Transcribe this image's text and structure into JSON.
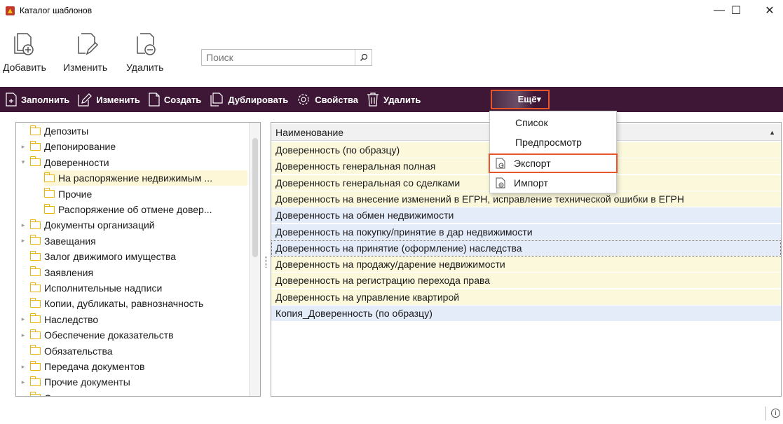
{
  "window": {
    "title": "Каталог шаблонов",
    "minimize": "—",
    "maximize": "☐",
    "close": "✕"
  },
  "ribbon": {
    "add_label": "Добавить",
    "edit_label": "Изменить",
    "delete_label": "Удалить",
    "search_placeholder": "Поиск"
  },
  "toolbar": {
    "fill": "Заполнить",
    "edit": "Изменить",
    "create": "Создать",
    "duplicate": "Дублировать",
    "properties": "Свойства",
    "delete": "Удалить",
    "more": "Ещё▾"
  },
  "menu": {
    "items": [
      "Список",
      "Предпросмотр",
      "Экспорт",
      "Импорт"
    ]
  },
  "tree": {
    "items": [
      {
        "label": "Депозиты",
        "level": 0,
        "expander": ""
      },
      {
        "label": "Депонирование",
        "level": 0,
        "expander": "▸"
      },
      {
        "label": "Доверенности",
        "level": 0,
        "expander": "▾"
      },
      {
        "label": "На распоряжение недвижимым ...",
        "level": 1,
        "expander": "",
        "selected": true
      },
      {
        "label": "Прочие",
        "level": 1,
        "expander": ""
      },
      {
        "label": "Распоряжение об отмене довер...",
        "level": 1,
        "expander": ""
      },
      {
        "label": "Документы организаций",
        "level": 0,
        "expander": "▸"
      },
      {
        "label": "Завещания",
        "level": 0,
        "expander": "▸"
      },
      {
        "label": "Залог движимого имущества",
        "level": 0,
        "expander": ""
      },
      {
        "label": "Заявления",
        "level": 0,
        "expander": ""
      },
      {
        "label": "Исполнительные надписи",
        "level": 0,
        "expander": ""
      },
      {
        "label": "Копии, дубликаты, равнозначность",
        "level": 0,
        "expander": ""
      },
      {
        "label": "Наследство",
        "level": 0,
        "expander": "▸"
      },
      {
        "label": "Обеспечение доказательств",
        "level": 0,
        "expander": "▸"
      },
      {
        "label": "Обязательства",
        "level": 0,
        "expander": ""
      },
      {
        "label": "Передача документов",
        "level": 0,
        "expander": "▸"
      },
      {
        "label": "Прочие документы",
        "level": 0,
        "expander": "▸"
      },
      {
        "label": "Свидетельства",
        "level": 0,
        "expander": ""
      }
    ]
  },
  "grid": {
    "header": "Наименование",
    "rows": [
      {
        "name": "Доверенность (по образцу)",
        "tone": "y"
      },
      {
        "name": "Доверенность генеральная полная",
        "tone": "y"
      },
      {
        "name": "Доверенность генеральная со сделками",
        "tone": "y"
      },
      {
        "name": "Доверенность на внесение изменений в ЕГРН, исправление технической ошибки в ЕГРН",
        "tone": "y"
      },
      {
        "name": "Доверенность на обмен недвижимости",
        "tone": "b"
      },
      {
        "name": "Доверенность на покупку/принятие в дар недвижимости",
        "tone": "b"
      },
      {
        "name": "Доверенность на принятие (оформление) наследства",
        "tone": "b",
        "focus": true
      },
      {
        "name": "Доверенность на продажу/дарение недвижимости",
        "tone": "y"
      },
      {
        "name": "Доверенность на регистрацию перехода права",
        "tone": "y"
      },
      {
        "name": "Доверенность на управление квартирой",
        "tone": "y"
      },
      {
        "name": "Копия_Доверенность (по образцу)",
        "tone": "b"
      }
    ]
  },
  "status": {
    "info": "i"
  }
}
